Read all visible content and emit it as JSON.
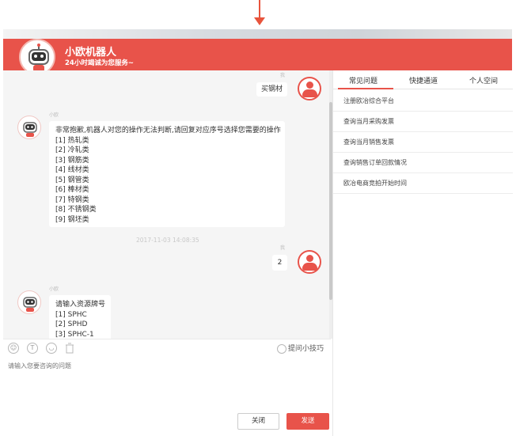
{
  "header": {
    "title": "小欧机器人",
    "subtitle": "24小时竭诚为您服务~"
  },
  "chat": {
    "messages": [
      {
        "from": "user",
        "sender": "我",
        "text": "买钢材"
      },
      {
        "from": "bot",
        "sender": "小欧",
        "intro": "非常抱歉,机器人对您的操作无法判断,请回复对应序号选择您需要的操作",
        "options": [
          "[1] 热轧类",
          "[2] 冷轧类",
          "[3] 钢筋类",
          "[4] 线材类",
          "[5] 钢管类",
          "[6] 棒材类",
          "[7] 特钢类",
          "[8] 不锈钢类",
          "[9] 钢坯类"
        ]
      },
      {
        "from": "user",
        "sender": "我",
        "text": "2",
        "timestamp": "2017-11-03 14:08:35"
      },
      {
        "from": "bot",
        "sender": "小欧",
        "intro": "请输入资源牌号",
        "options": [
          "[1] SPHC",
          "[2] SPHD",
          "[3] SPHC-1"
        ]
      }
    ]
  },
  "toolbar": {
    "tips_label": "提问小技巧",
    "icons": [
      "smile-icon",
      "text-icon",
      "shield-icon",
      "trash-icon"
    ],
    "text_icon_glyph": "T"
  },
  "input": {
    "placeholder": "请输入您要咨询的问题"
  },
  "buttons": {
    "close": "关闭",
    "send": "发送"
  },
  "right_panel": {
    "tabs": [
      "常见问题",
      "快捷通道",
      "个人空间"
    ],
    "faq": [
      "注册欧冶综合平台",
      "查询当月采购发票",
      "查询当月销售发票",
      "查询销售订单回款情况",
      "欧冶电商竞拍开始时间"
    ]
  },
  "colors": {
    "brand_red": "#e8534a",
    "background_chat": "#f5f5f5"
  }
}
